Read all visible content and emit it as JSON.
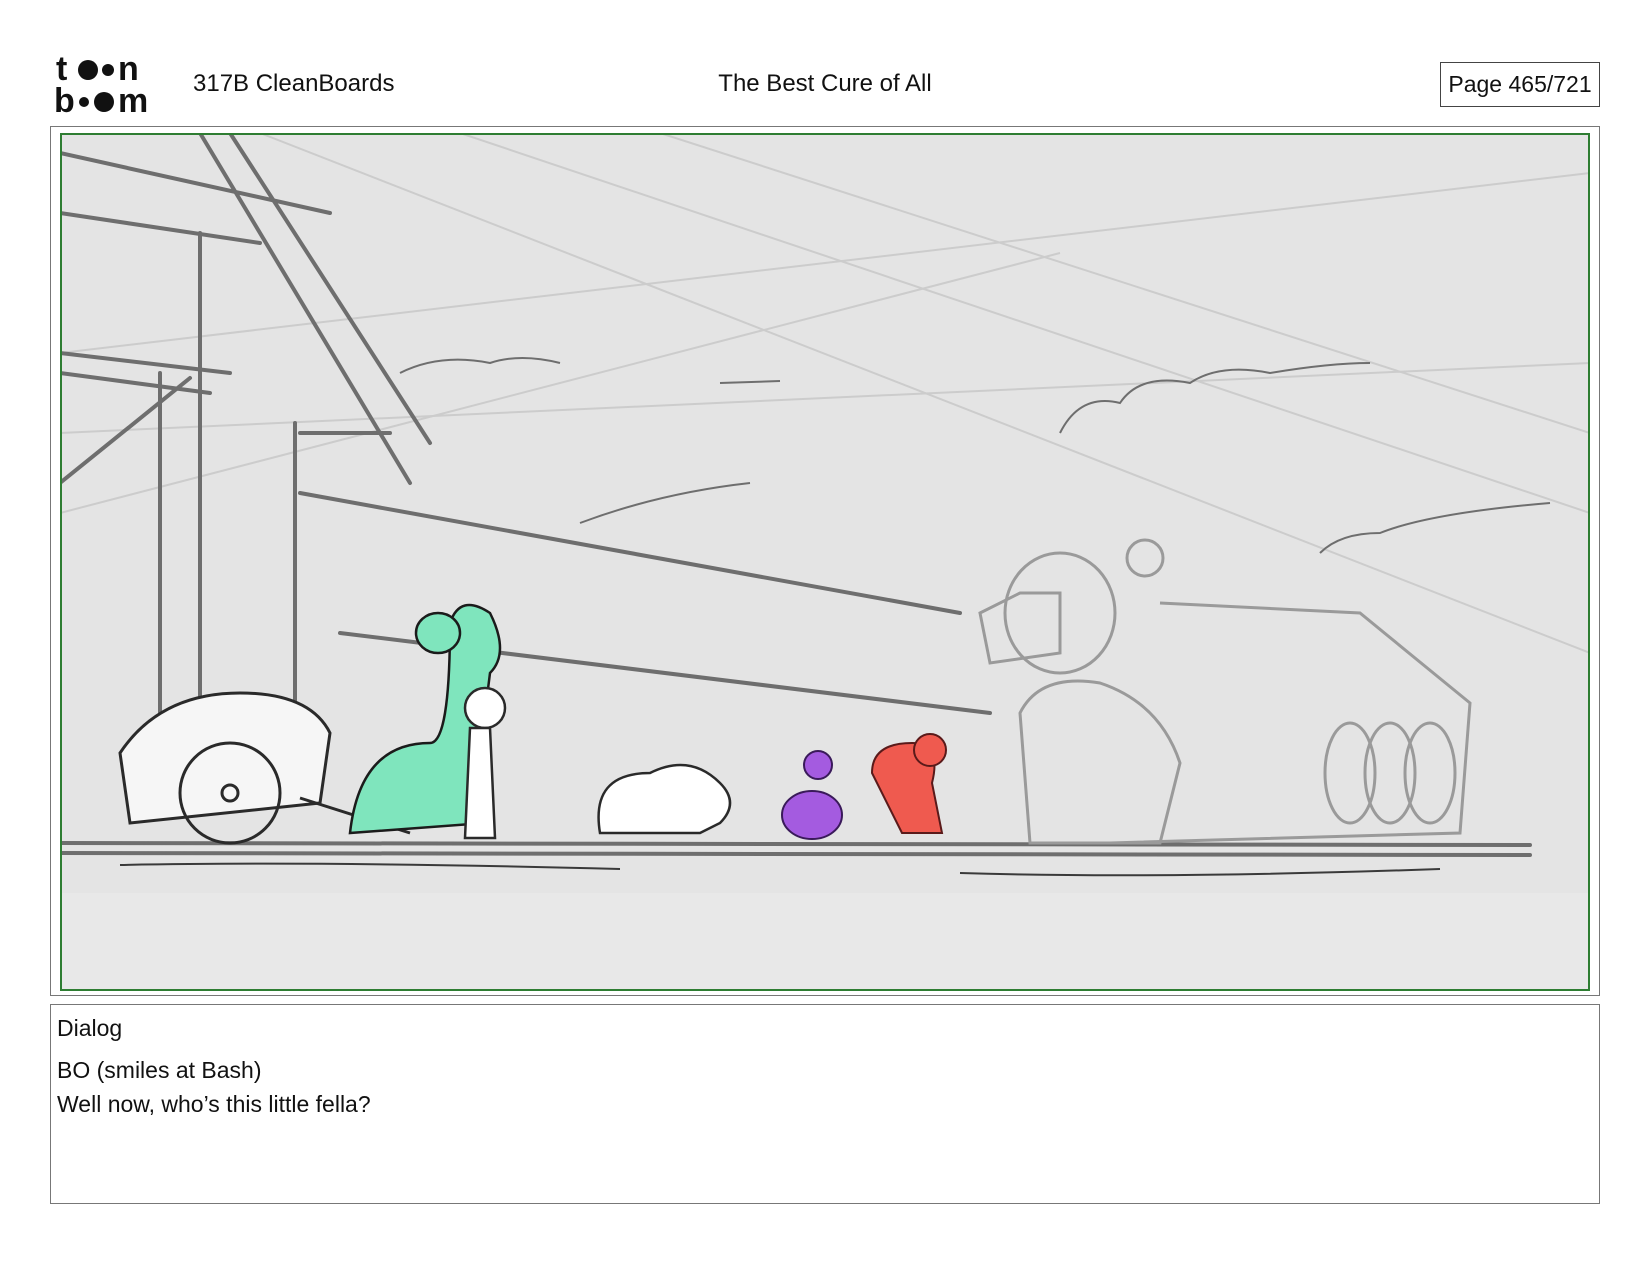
{
  "header": {
    "logo_text_top": "toon",
    "logo_text_bottom": "boom",
    "scene_id": "317B  CleanBoards",
    "episode_title": "The Best Cure of All",
    "page_indicator": "Page 465/721"
  },
  "dialog": {
    "label": "Dialog",
    "speaker_line": "BO (smiles at Bash)",
    "line": "Well now, who’s this little fella?"
  },
  "colors": {
    "safe_frame": "#2e7d32",
    "sky": "#e4e4e4",
    "sketch": "#6e6e6e",
    "green_character": "#7fe5bd",
    "purple_character": "#a45be0",
    "red_character": "#ef5a4f"
  }
}
